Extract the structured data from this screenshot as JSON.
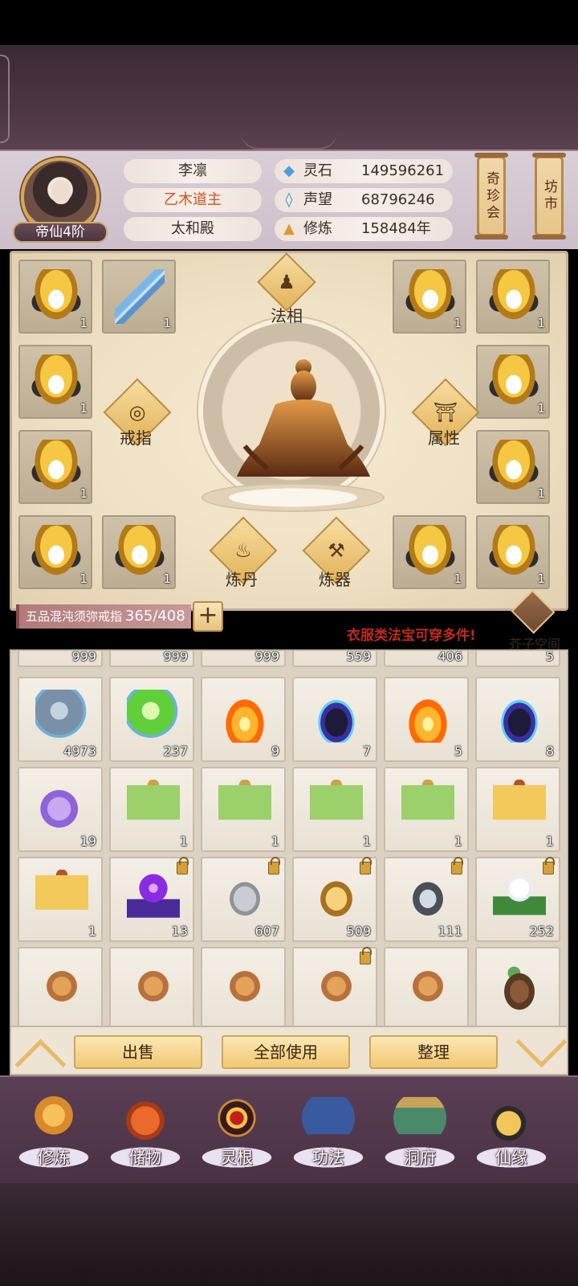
{
  "player": {
    "name": "李凛",
    "title": "乙木道主",
    "sect": "太和殿",
    "rank": "帝仙4阶"
  },
  "stats": [
    {
      "icon": "spirit-stone-icon",
      "glyph": "◆",
      "color": "#4a9fe0",
      "label": "灵石",
      "value": "149596261"
    },
    {
      "icon": "prestige-icon",
      "glyph": "◊",
      "color": "#3a8fd8",
      "label": "声望",
      "value": "68796246"
    },
    {
      "icon": "cultivation-icon",
      "glyph": "▲",
      "color": "#d99a3a",
      "label": "修炼",
      "value": "158484年"
    }
  ],
  "side_buttons": {
    "treasure": "奇珍会",
    "market": "坊市"
  },
  "equip": {
    "dharma_label": "法相",
    "ring_label": "戒指",
    "attr_label": "属性",
    "alchemy_label": "炼丹",
    "forge_label": "炼器",
    "slot_count": "1"
  },
  "capacity": {
    "ring_name": "五品混沌须弥戒指",
    "count": "365/408",
    "plus": "+"
  },
  "hint": "衣服类法宝可穿多件!",
  "space_label": "芥子空间",
  "bag": {
    "partial_counts": [
      "999",
      "999",
      "999",
      "559",
      "406",
      "5"
    ],
    "rows": [
      [
        {
          "icon": "water-orb-icon",
          "cls": "i-orb-grey",
          "count": "4973",
          "locked": false
        },
        {
          "icon": "wood-orb-icon",
          "cls": "i-orb-green",
          "count": "237",
          "locked": false
        },
        {
          "icon": "fire-flame-icon",
          "cls": "i-fire",
          "count": "9",
          "locked": false
        },
        {
          "icon": "dark-flame-icon",
          "cls": "i-dark",
          "count": "7",
          "locked": false
        },
        {
          "icon": "fire-flame-icon",
          "cls": "i-fire",
          "count": "5",
          "locked": false
        },
        {
          "icon": "dark-flame-icon",
          "cls": "i-dark",
          "count": "8",
          "locked": false
        }
      ],
      [
        {
          "icon": "purple-cloud-icon",
          "cls": "i-cloud",
          "count": "19",
          "locked": false
        },
        {
          "icon": "green-banner-icon",
          "cls": "i-banner-g",
          "count": "1",
          "locked": false
        },
        {
          "icon": "green-banner-icon",
          "cls": "i-banner-g",
          "count": "1",
          "locked": false
        },
        {
          "icon": "green-banner-icon",
          "cls": "i-banner-g",
          "count": "1",
          "locked": false
        },
        {
          "icon": "green-banner-icon",
          "cls": "i-banner-g",
          "count": "1",
          "locked": false
        },
        {
          "icon": "yellow-banner-icon",
          "cls": "i-banner-y",
          "count": "1",
          "locked": false
        }
      ],
      [
        {
          "icon": "yellow-banner-icon",
          "cls": "i-banner-y",
          "count": "1",
          "locked": false
        },
        {
          "icon": "purple-orb-stand-icon",
          "cls": "i-purple-orb",
          "count": "13",
          "locked": true
        },
        {
          "icon": "silver-ore-icon",
          "cls": "i-rock",
          "count": "607",
          "locked": true
        },
        {
          "icon": "gold-ore-icon",
          "cls": "i-gold",
          "count": "509",
          "locked": true
        },
        {
          "icon": "iron-ore-icon",
          "cls": "i-iron",
          "count": "111",
          "locked": true
        },
        {
          "icon": "white-flower-icon",
          "cls": "i-flower",
          "count": "252",
          "locked": true
        }
      ],
      [
        {
          "icon": "ginseng-icon",
          "cls": "i-ginseng",
          "count": "",
          "locked": false
        },
        {
          "icon": "ginseng-icon",
          "cls": "i-ginseng",
          "count": "",
          "locked": false
        },
        {
          "icon": "ginseng-icon",
          "cls": "i-ginseng",
          "count": "",
          "locked": false
        },
        {
          "icon": "ginseng-icon",
          "cls": "i-ginseng",
          "count": "",
          "locked": true
        },
        {
          "icon": "ginseng-icon",
          "cls": "i-ginseng",
          "count": "",
          "locked": false
        },
        {
          "icon": "herb-root-icon",
          "cls": "i-root",
          "count": "",
          "locked": false
        }
      ]
    ]
  },
  "actions": {
    "sell": "出售",
    "use_all": "全部使用",
    "sort": "整理"
  },
  "nav": [
    {
      "label": "修炼",
      "cls": "n-1",
      "icon": "cultivate-figure-icon"
    },
    {
      "label": "储物",
      "cls": "n-2",
      "icon": "storage-bag-icon"
    },
    {
      "label": "灵根",
      "cls": "n-3",
      "icon": "spirit-root-icon"
    },
    {
      "label": "功法",
      "cls": "n-4",
      "icon": "technique-book-icon"
    },
    {
      "label": "洞府",
      "cls": "n-5",
      "icon": "cave-residence-icon"
    },
    {
      "label": "仙缘",
      "cls": "n-6",
      "icon": "destiny-gourd-icon"
    }
  ]
}
